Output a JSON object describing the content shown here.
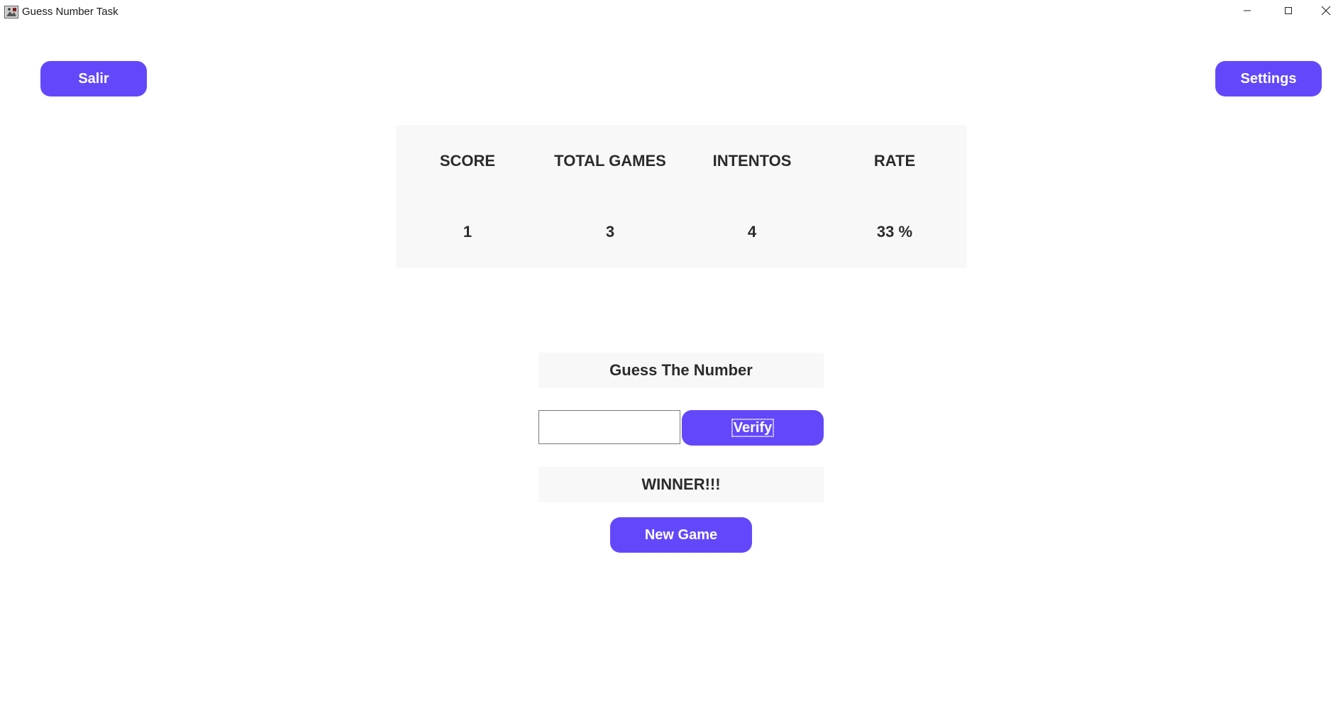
{
  "window": {
    "title": "Guess Number Task",
    "controls": {
      "minimize_icon": "minimize-icon",
      "maximize_icon": "maximize-icon",
      "close_icon": "close-icon"
    }
  },
  "top_buttons": {
    "exit_label": "Salir",
    "settings_label": "Settings"
  },
  "stats": {
    "headers": [
      "SCORE",
      "TOTAL GAMES",
      "INTENTOS",
      "RATE"
    ],
    "values": [
      "1",
      "3",
      "4",
      "33 %"
    ]
  },
  "game": {
    "title": "Guess The Number",
    "input_value": "",
    "verify_label": "Verify",
    "result": "WINNER!!!",
    "new_game_label": "New Game"
  },
  "colors": {
    "accent": "#6348fb",
    "panel_bg": "#f8f8f8",
    "text": "#2b2b2b"
  }
}
